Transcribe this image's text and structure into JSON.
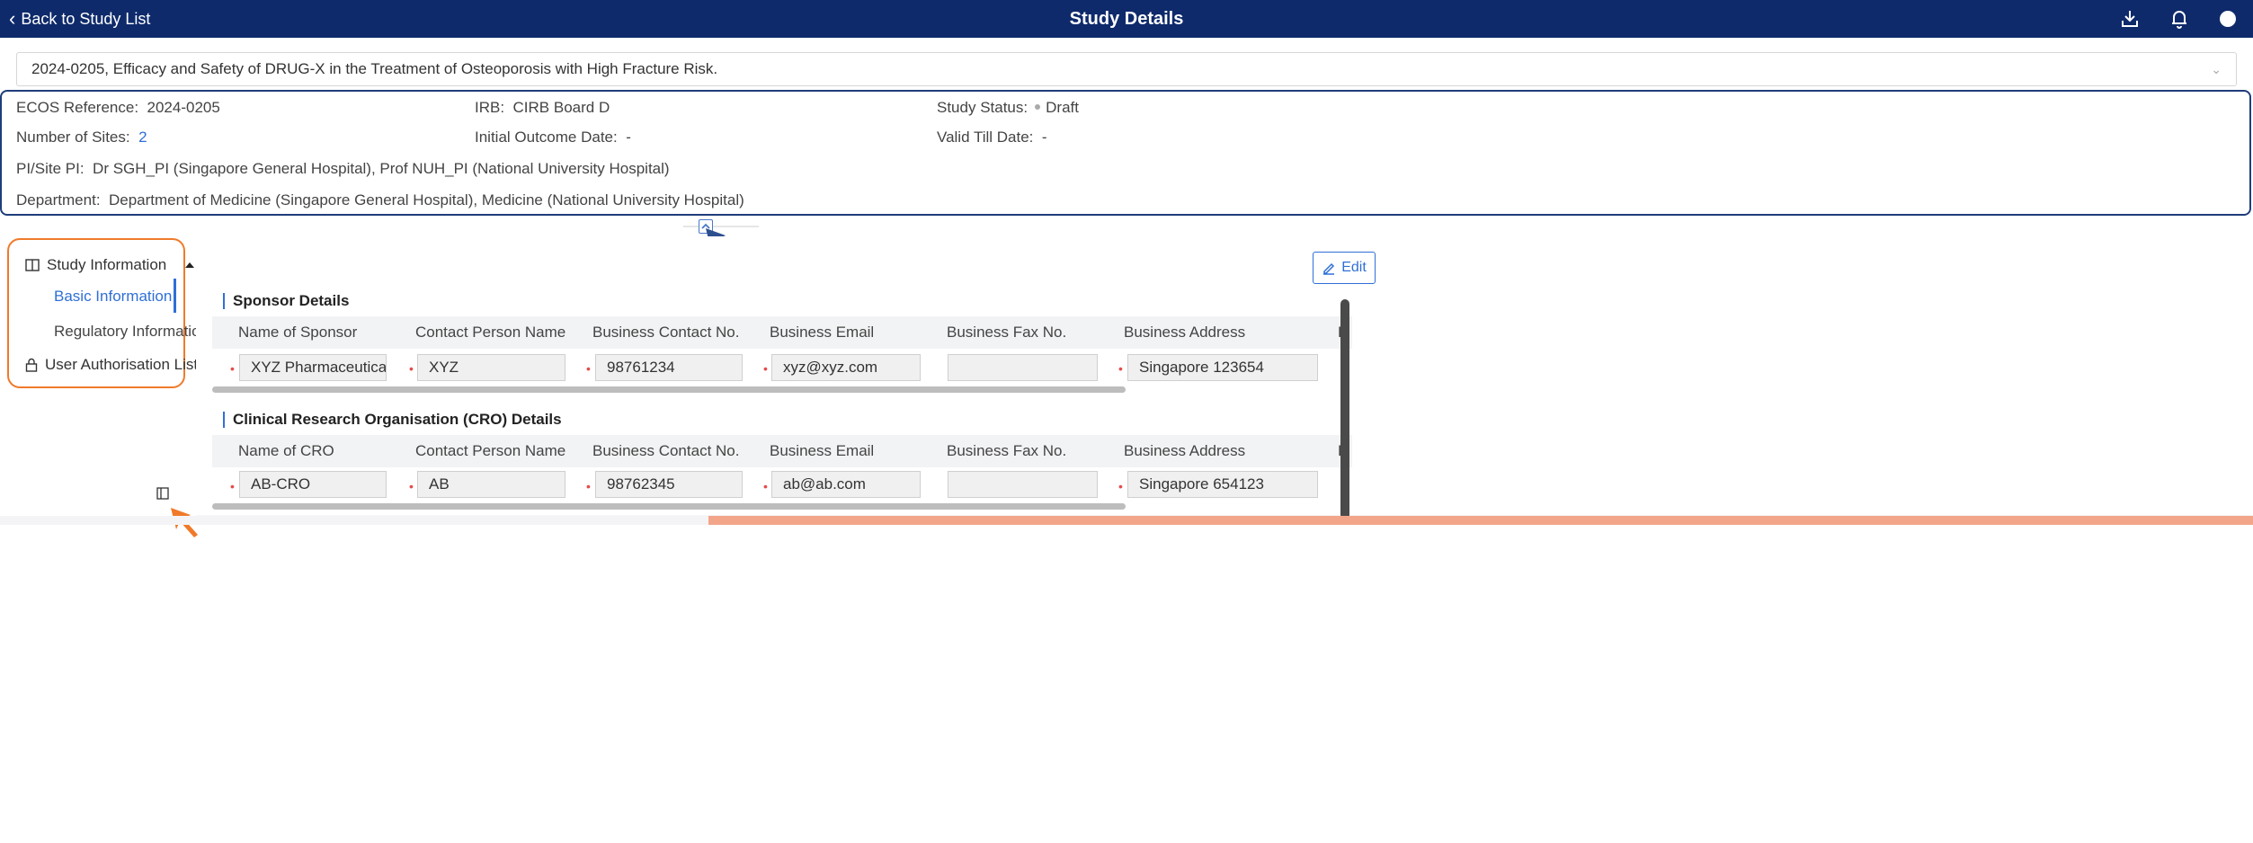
{
  "header": {
    "back_label": "Back to Study List",
    "title": "Study Details",
    "icons": [
      "download-icon",
      "bell-icon",
      "user-avatar"
    ],
    "bg_color": "#0e2a6b"
  },
  "study_select": {
    "value": "2024-0205, Efficacy and Safety of DRUG-X in the Treatment of Osteoporosis with High Fracture Risk."
  },
  "summary": {
    "ecos_label": "ECOS Reference:",
    "ecos_value": "2024-0205",
    "irb_label": "IRB:",
    "irb_value": "CIRB Board D",
    "status_label": "Study Status:",
    "status_value": "Draft",
    "sites_label": "Number of Sites:",
    "sites_value": "2",
    "outcome_label": "Initial Outcome Date:",
    "outcome_value": "-",
    "valid_label": "Valid Till Date:",
    "valid_value": "-",
    "pi_label": "PI/Site PI:",
    "pi_value": "Dr SGH_PI (Singapore General Hospital), Prof NUH_PI (National University Hospital)",
    "dept_label": "Department:",
    "dept_value": "Department of Medicine (Singapore General Hospital), Medicine (National University Hospital)"
  },
  "nav": {
    "study_info": "Study Information",
    "basic_info": "Basic Information",
    "regulatory_info": "Regulatory Information",
    "user_auth": "User Authorisation List"
  },
  "edit_label": "Edit",
  "sponsor": {
    "title": "Sponsor Details",
    "columns": [
      "Name of Sponsor",
      "Contact Person Name",
      "Business Contact No.",
      "Business Email",
      "Business Fax No.",
      "Business Address",
      "L"
    ],
    "values": [
      "XYZ Pharmaceuticals",
      "XYZ",
      "98761234",
      "xyz@xyz.com",
      "",
      "Singapore 123654"
    ]
  },
  "cro": {
    "title": "Clinical Research Organisation (CRO) Details",
    "columns": [
      "Name of CRO",
      "Contact Person Name",
      "Business Contact No.",
      "Business Email",
      "Business Fax No.",
      "Business Address",
      "L"
    ],
    "values": [
      "AB-CRO",
      "AB",
      "98762345",
      "ab@ab.com",
      "",
      "Singapore 654123"
    ]
  },
  "accent_color": "#2f6fd6",
  "highlight_color": "#f07a2a"
}
